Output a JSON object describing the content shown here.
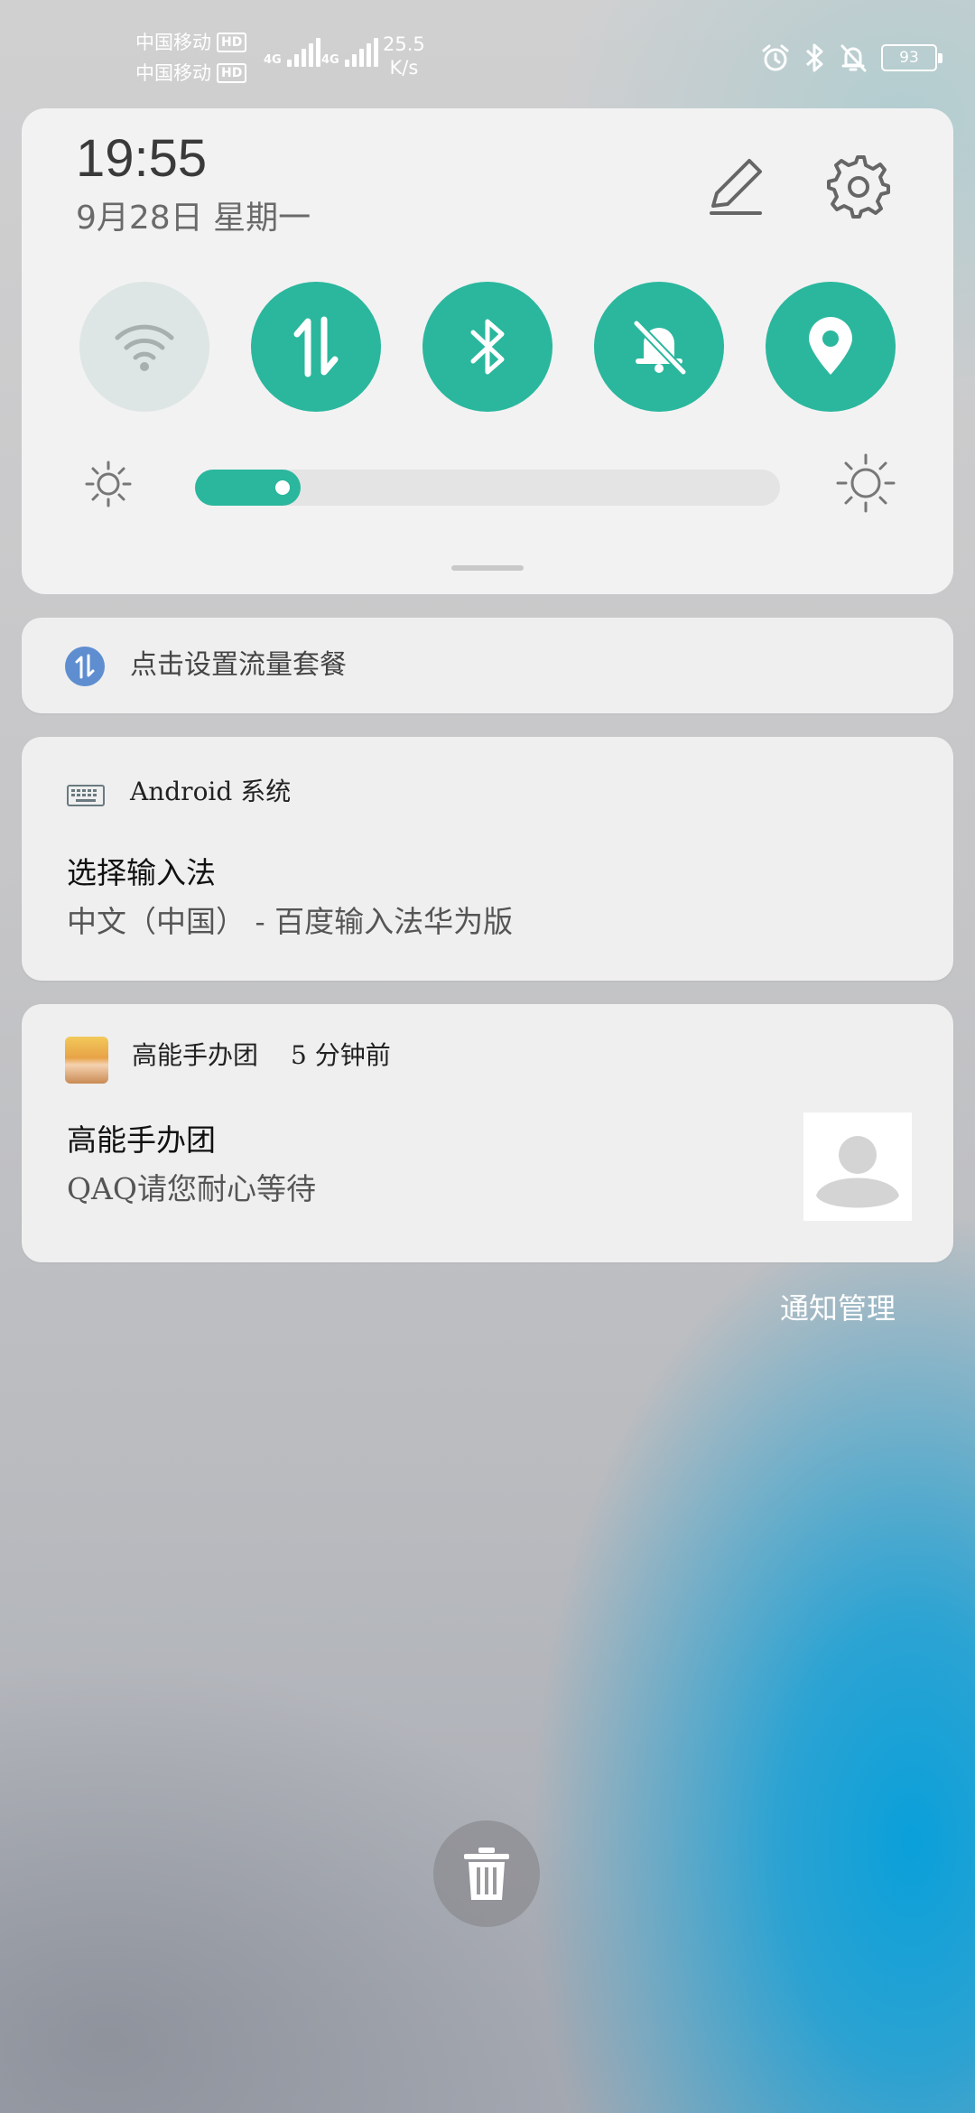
{
  "status_bar": {
    "carrier1": "中国移动",
    "carrier2": "中国移动",
    "hd_label": "HD",
    "network_type": "4G",
    "speed_value": "25.5",
    "speed_unit": "K/s",
    "battery": "93",
    "icons": [
      "alarm-icon",
      "bluetooth-icon",
      "mute-bell-icon",
      "battery-icon"
    ]
  },
  "quick_settings": {
    "time": "19:55",
    "date": "9月28日 星期一",
    "tiles": [
      {
        "name": "wifi",
        "state": "off"
      },
      {
        "name": "mobile-data",
        "state": "on"
      },
      {
        "name": "bluetooth",
        "state": "on"
      },
      {
        "name": "mute",
        "state": "on"
      },
      {
        "name": "location",
        "state": "on"
      }
    ],
    "brightness_level": 0.18,
    "accent_color": "#2ab79d"
  },
  "notifications": {
    "data_plan": {
      "text": "点击设置流量套餐"
    },
    "android": {
      "app": "Android 系统",
      "title": "选择输入法",
      "body": "中文（中国） - 百度输入法华为版"
    },
    "game": {
      "app": "高能手办团",
      "time": "5 分钟前",
      "title": "高能手办团",
      "body": "QAQ请您耐心等待"
    }
  },
  "footer": {
    "manage_label": "通知管理"
  }
}
